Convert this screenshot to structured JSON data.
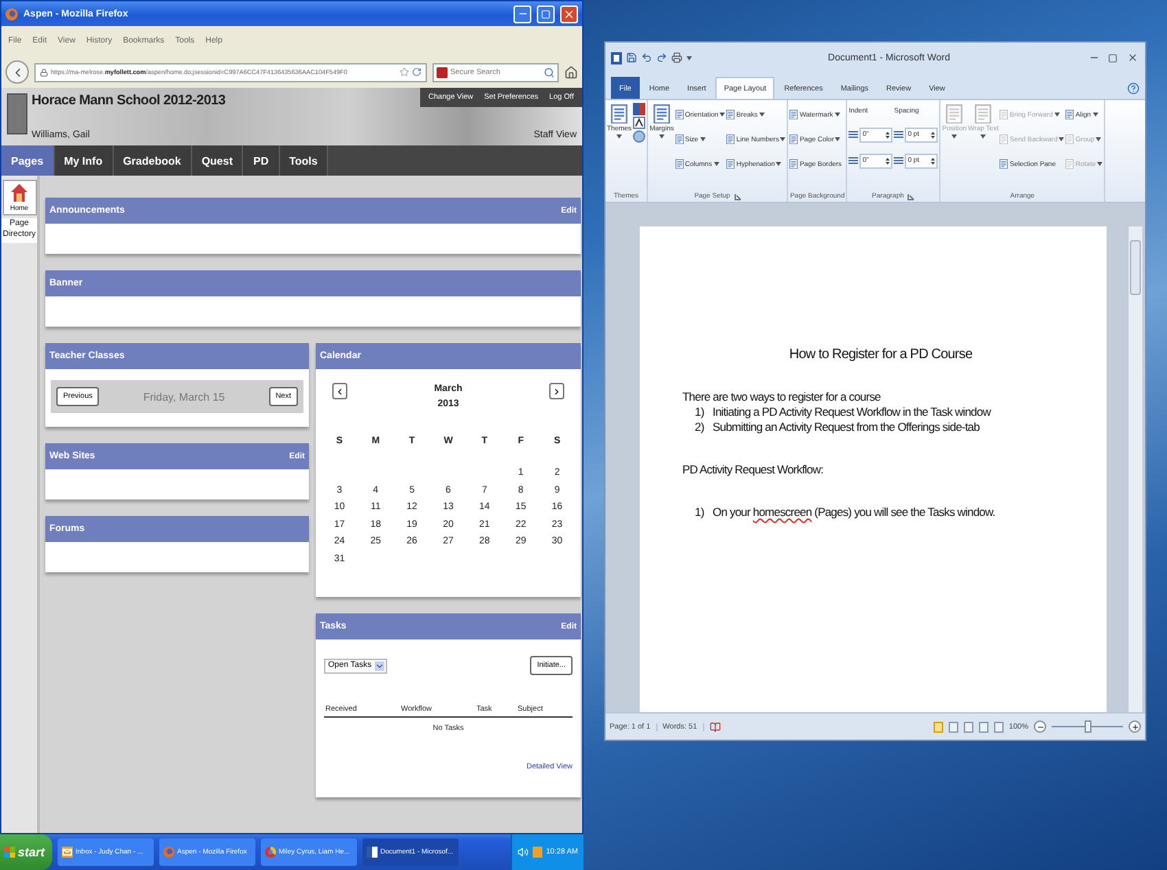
{
  "firefox": {
    "title": "Aspen - Mozilla Firefox",
    "menu": [
      "File",
      "Edit",
      "View",
      "History",
      "Bookmarks",
      "Tools",
      "Help"
    ],
    "url": "https://ma-melrose.**myfollett.com**/aspen/home.do;jsessionid=C997A6CC47F4136435636AAC104F549F0",
    "search": {
      "placeholder": "Secure Search"
    }
  },
  "aspen": {
    "school": "Horace Mann School 2012-2013",
    "user": "Williams, Gail",
    "links": [
      "Change View",
      "Set Preferences",
      "Log Off"
    ],
    "view": "Staff View",
    "tabs": [
      {
        "label": "Pages",
        "selected": true
      },
      {
        "label": "My Info",
        "selected": false
      },
      {
        "label": "Gradebook",
        "selected": false
      },
      {
        "label": "Quest",
        "selected": false
      },
      {
        "label": "PD",
        "selected": false
      },
      {
        "label": "Tools",
        "selected": false
      }
    ],
    "sidebar": [
      {
        "label": "Home",
        "kind": "tile"
      },
      {
        "label": "Page Directory",
        "kind": "text"
      }
    ],
    "wide_widgets": [
      {
        "title": "Announcements",
        "kind": "empty",
        "edit": "Edit"
      },
      {
        "title": "Banner",
        "kind": "empty"
      }
    ],
    "left_widgets": [
      {
        "title": "Teacher Classes",
        "kind": "classes",
        "previous": "Previous",
        "date": "Friday, March 15",
        "next": "Next"
      },
      {
        "title": "Web Sites",
        "kind": "empty",
        "edit": "Edit"
      },
      {
        "title": "Forums",
        "kind": "empty"
      }
    ],
    "right_widgets": [
      {
        "title": "Calendar",
        "kind": "calendar",
        "month": "March",
        "year": "2013",
        "weekdays": [
          "S",
          "M",
          "T",
          "W",
          "T",
          "F",
          "S"
        ],
        "weeks": [
          [
            "1",
            "2"
          ],
          [
            "3",
            "4",
            "5",
            "6",
            "7",
            "8",
            "9"
          ],
          [
            "10",
            "11",
            "12",
            "13",
            "14",
            "15",
            "16"
          ],
          [
            "17",
            "18",
            "19",
            "20",
            "21",
            "22",
            "23"
          ],
          [
            "24",
            "25",
            "26",
            "27",
            "28",
            "29",
            "30"
          ],
          [
            "31"
          ]
        ]
      },
      {
        "title": "Tasks",
        "kind": "tasks",
        "edit": "Edit",
        "filter": "Open Tasks",
        "initiate": "Initiate...",
        "columns": [
          "Received",
          "Workflow",
          "Task",
          "Subject"
        ],
        "empty": "No Tasks",
        "link": "Detailed View"
      }
    ]
  },
  "taskbar": {
    "start": "start",
    "tasks": [
      {
        "label": "Inbox - Judy Chan - ...",
        "kind": "mail",
        "selected": false
      },
      {
        "label": "Aspen - Mozilla Firefox",
        "kind": "browser",
        "selected": false
      },
      {
        "label": "Miley Cyrus, Liam He...",
        "kind": "globe",
        "selected": false
      },
      {
        "label": "Document1 - Microsof...",
        "kind": "document",
        "selected": true
      }
    ],
    "clock": "10:28 AM"
  },
  "word": {
    "title": "Document1 - Microsoft Word",
    "tabs": [
      {
        "label": "File",
        "kind": "file",
        "selected": false
      },
      {
        "label": "Home",
        "kind": "tab",
        "selected": false
      },
      {
        "label": "Insert",
        "kind": "tab",
        "selected": false
      },
      {
        "label": "Page Layout",
        "kind": "tab",
        "selected": true
      },
      {
        "label": "References",
        "kind": "tab",
        "selected": false
      },
      {
        "label": "Mailings",
        "kind": "tab",
        "selected": false
      },
      {
        "label": "Review",
        "kind": "tab",
        "selected": false
      },
      {
        "label": "View",
        "kind": "tab",
        "selected": false
      }
    ],
    "groups": [
      {
        "label": "Themes",
        "kind": "themes",
        "launcher": false,
        "columns": [
          [
            {
              "label": "Themes",
              "kind": "large",
              "menu": true,
              "disabled": false
            }
          ]
        ]
      },
      {
        "label": "Page Setup",
        "kind": "buttons",
        "launcher": true,
        "columns": [
          [
            {
              "label": "Margins",
              "kind": "large",
              "menu": true,
              "disabled": false
            }
          ],
          [
            {
              "label": "Orientation",
              "kind": "small",
              "menu": true,
              "disabled": false
            },
            {
              "label": "Size",
              "kind": "small",
              "menu": true,
              "disabled": false
            },
            {
              "label": "Columns",
              "kind": "small",
              "menu": true,
              "disabled": false
            }
          ],
          [
            {
              "label": "Breaks",
              "kind": "small",
              "menu": true,
              "disabled": false
            },
            {
              "label": "Line Numbers",
              "kind": "small",
              "menu": true,
              "disabled": false
            },
            {
              "label": "Hyphenation",
              "kind": "small",
              "menu": true,
              "disabled": false
            }
          ]
        ]
      },
      {
        "label": "Page Background",
        "kind": "buttons",
        "launcher": false,
        "columns": [
          [
            {
              "label": "Watermark",
              "kind": "small",
              "menu": true,
              "disabled": false
            },
            {
              "label": "Page Color",
              "kind": "small",
              "menu": true,
              "disabled": false
            },
            {
              "label": "Page Borders",
              "kind": "small",
              "menu": false,
              "disabled": false
            }
          ]
        ]
      },
      {
        "label": "Paragraph",
        "kind": "spinners",
        "launcher": true,
        "columns": [
          {
            "heading": "Indent",
            "values": [
              "0\"",
              "0\""
            ]
          },
          {
            "heading": "Spacing",
            "values": [
              "0 pt",
              "0 pt"
            ]
          }
        ]
      },
      {
        "label": "Arrange",
        "kind": "buttons",
        "launcher": false,
        "columns": [
          [
            {
              "label": "Position",
              "kind": "large",
              "menu": true,
              "disabled": true
            }
          ],
          [
            {
              "label": "Wrap Text",
              "kind": "large",
              "menu": true,
              "disabled": true
            }
          ],
          [
            {
              "label": "Bring Forward",
              "kind": "small",
              "menu": true,
              "disabled": true
            },
            {
              "label": "Send Backward",
              "kind": "small",
              "menu": true,
              "disabled": true
            },
            {
              "label": "Selection Pane",
              "kind": "small",
              "menu": false,
              "disabled": false
            }
          ],
          [
            {
              "label": "Align",
              "kind": "small",
              "menu": true,
              "disabled": false
            },
            {
              "label": "Group",
              "kind": "small",
              "menu": true,
              "disabled": true
            },
            {
              "label": "Rotate",
              "kind": "small",
              "menu": true,
              "disabled": true
            }
          ]
        ]
      }
    ],
    "document": [
      {
        "kind": "heading",
        "text": "How to Register for a PD Course"
      },
      {
        "kind": "p",
        "space_before": true,
        "text": "There are two ways to register for a course"
      },
      {
        "kind": "list",
        "space_before": false,
        "items": [
          {
            "marker": "1)",
            "text": "Initiating a PD Activity Request Workflow in the Task window"
          },
          {
            "marker": "2)",
            "text": "Submitting an Activity Request from the Offerings side-tab"
          }
        ]
      },
      {
        "kind": "p",
        "space_before": true,
        "text": "PD Activity Request Workflow:"
      },
      {
        "kind": "list",
        "space_before": true,
        "items": [
          {
            "marker": "1)",
            "parts": [
              {
                "text": "On your ",
                "misspelled": false
              },
              {
                "text": "homescreen",
                "misspelled": true
              },
              {
                "text": " (Pages) you will see the Tasks window.",
                "misspelled": false
              }
            ]
          }
        ]
      }
    ],
    "status": {
      "page": "Page: 1 of 1",
      "words": "Words: 51",
      "zoom": "100%",
      "zoom_slider": {
        "level": 0.5
      }
    }
  }
}
